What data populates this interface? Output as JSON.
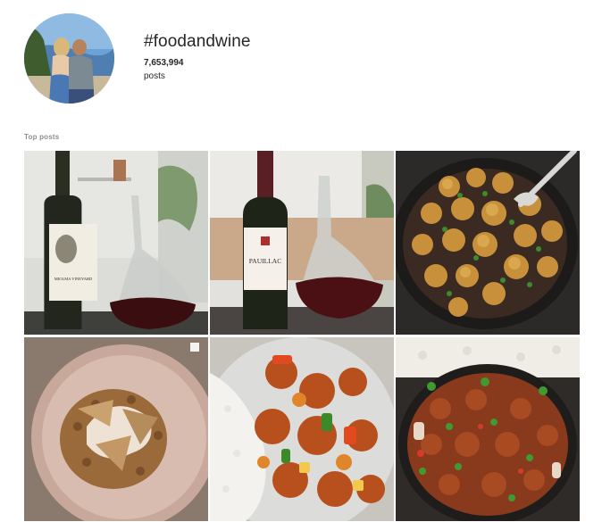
{
  "hashtag": {
    "title": "#foodandwine",
    "post_count": "7,653,994",
    "posts_label": "posts"
  },
  "section": {
    "top_posts_label": "Top posts"
  },
  "wine_label_1": {
    "text": "MIOLMA VINEYARD"
  },
  "wine_label_2": {
    "text": "PAUILLAC"
  },
  "colors": {
    "text_primary": "#262626",
    "text_secondary": "#8e8e8e",
    "background": "#ffffff"
  }
}
